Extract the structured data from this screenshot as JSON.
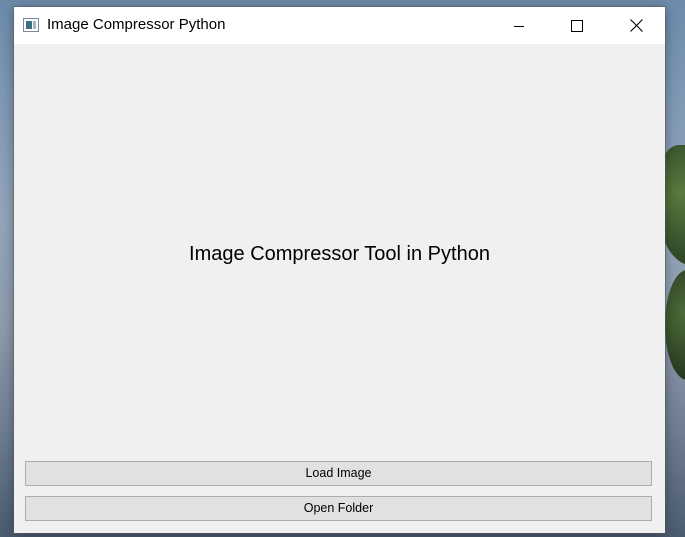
{
  "window": {
    "title": "Image Compressor Python",
    "controls": {
      "minimize_icon": "minimize-icon",
      "maximize_icon": "maximize-icon",
      "close_icon": "close-icon"
    }
  },
  "main": {
    "heading": "Image Compressor Tool in Python"
  },
  "buttons": {
    "load_image": "Load Image",
    "open_folder": "Open Folder"
  },
  "colors": {
    "titlebar_bg": "#ffffff",
    "client_bg": "#f0f0f0",
    "button_bg": "#e1e1e1",
    "button_border": "#adadad"
  }
}
